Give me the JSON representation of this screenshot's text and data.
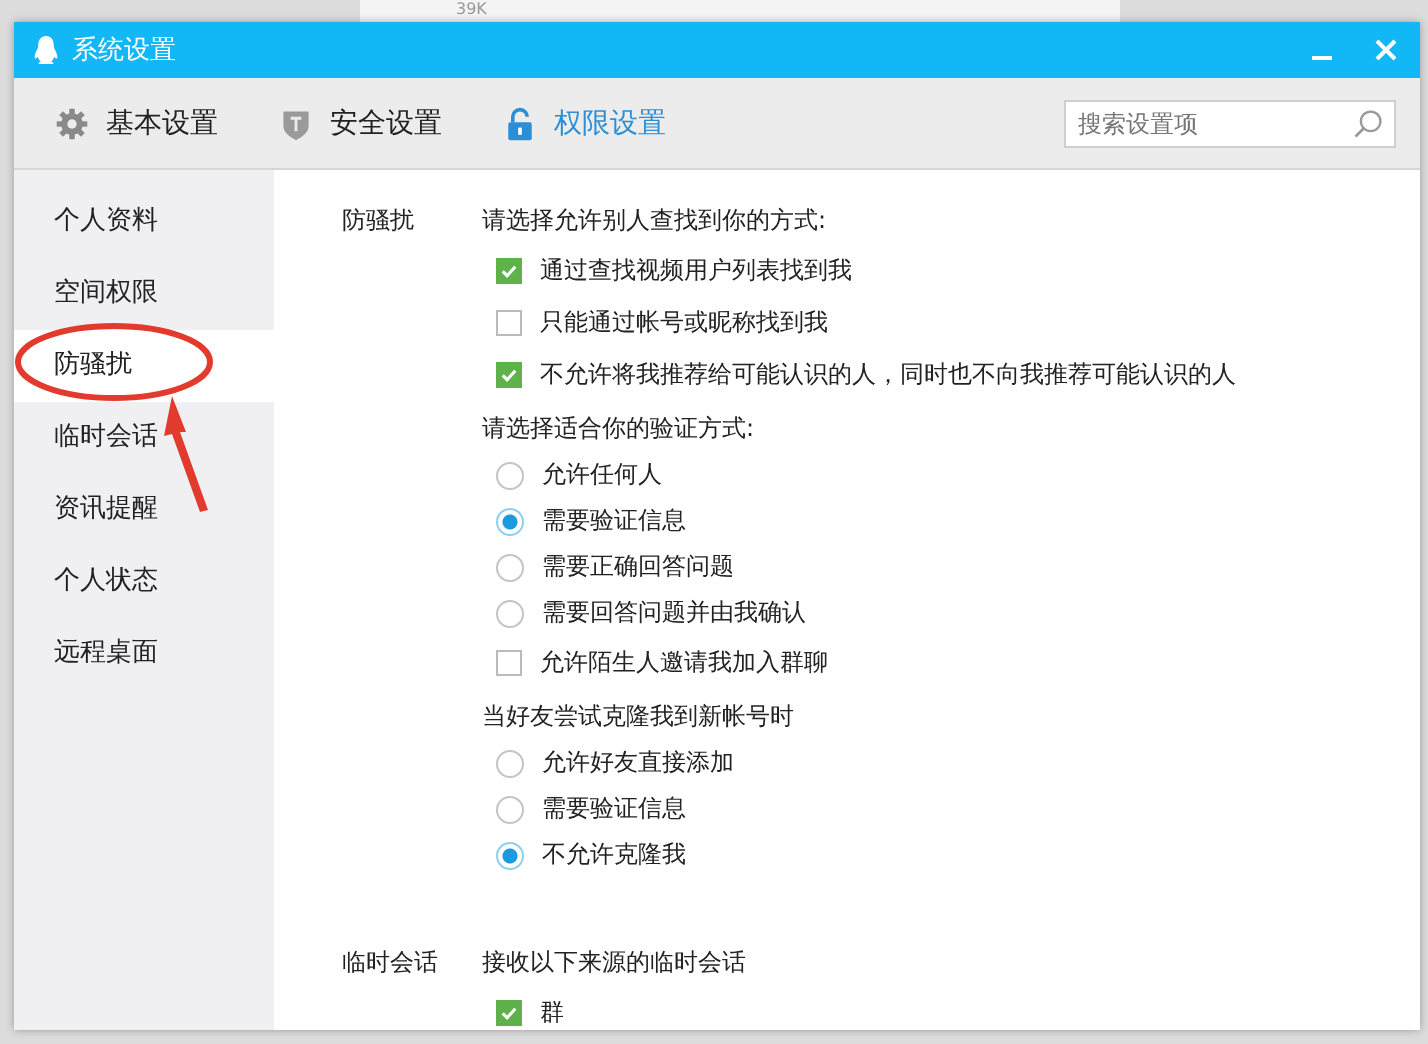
{
  "background": {
    "text": "39K"
  },
  "window": {
    "title": "系统设置"
  },
  "tabs": [
    {
      "label": "基本设置",
      "selected": false
    },
    {
      "label": "安全设置",
      "selected": false
    },
    {
      "label": "权限设置",
      "selected": true
    }
  ],
  "search": {
    "placeholder": "搜索设置项"
  },
  "sidebar": {
    "items": [
      {
        "label": "个人资料",
        "selected": false
      },
      {
        "label": "空间权限",
        "selected": false
      },
      {
        "label": "防骚扰",
        "selected": true
      },
      {
        "label": "临时会话",
        "selected": false
      },
      {
        "label": "资讯提醒",
        "selected": false
      },
      {
        "label": "个人状态",
        "selected": false
      },
      {
        "label": "远程桌面",
        "selected": false
      }
    ]
  },
  "sections": [
    {
      "label": "防骚扰",
      "groups": [
        {
          "heading": "请选择允许别人查找到你的方式:",
          "options": [
            {
              "kind": "checkbox",
              "label": "通过查找视频用户列表找到我",
              "checked": true
            },
            {
              "kind": "checkbox",
              "label": "只能通过帐号或昵称找到我",
              "checked": false
            },
            {
              "kind": "checkbox",
              "label": "不允许将我推荐给可能认识的人，同时也不向我推荐可能认识的人",
              "checked": true
            }
          ]
        },
        {
          "heading": "请选择适合你的验证方式:",
          "options": [
            {
              "kind": "radio",
              "label": "允许任何人",
              "selected": false
            },
            {
              "kind": "radio",
              "label": "需要验证信息",
              "selected": true
            },
            {
              "kind": "radio",
              "label": "需要正确回答问题",
              "selected": false
            },
            {
              "kind": "radio",
              "label": "需要回答问题并由我确认",
              "selected": false
            },
            {
              "kind": "checkbox",
              "label": "允许陌生人邀请我加入群聊",
              "checked": false
            }
          ]
        },
        {
          "heading": "当好友尝试克隆我到新帐号时",
          "options": [
            {
              "kind": "radio",
              "label": "允许好友直接添加",
              "selected": false
            },
            {
              "kind": "radio",
              "label": "需要验证信息",
              "selected": false
            },
            {
              "kind": "radio",
              "label": "不允许克隆我",
              "selected": true
            }
          ]
        }
      ]
    },
    {
      "label": "临时会话",
      "groups": [
        {
          "heading": "接收以下来源的临时会话",
          "options": [
            {
              "kind": "checkbox",
              "label": "群",
              "checked": true
            }
          ]
        }
      ]
    }
  ]
}
